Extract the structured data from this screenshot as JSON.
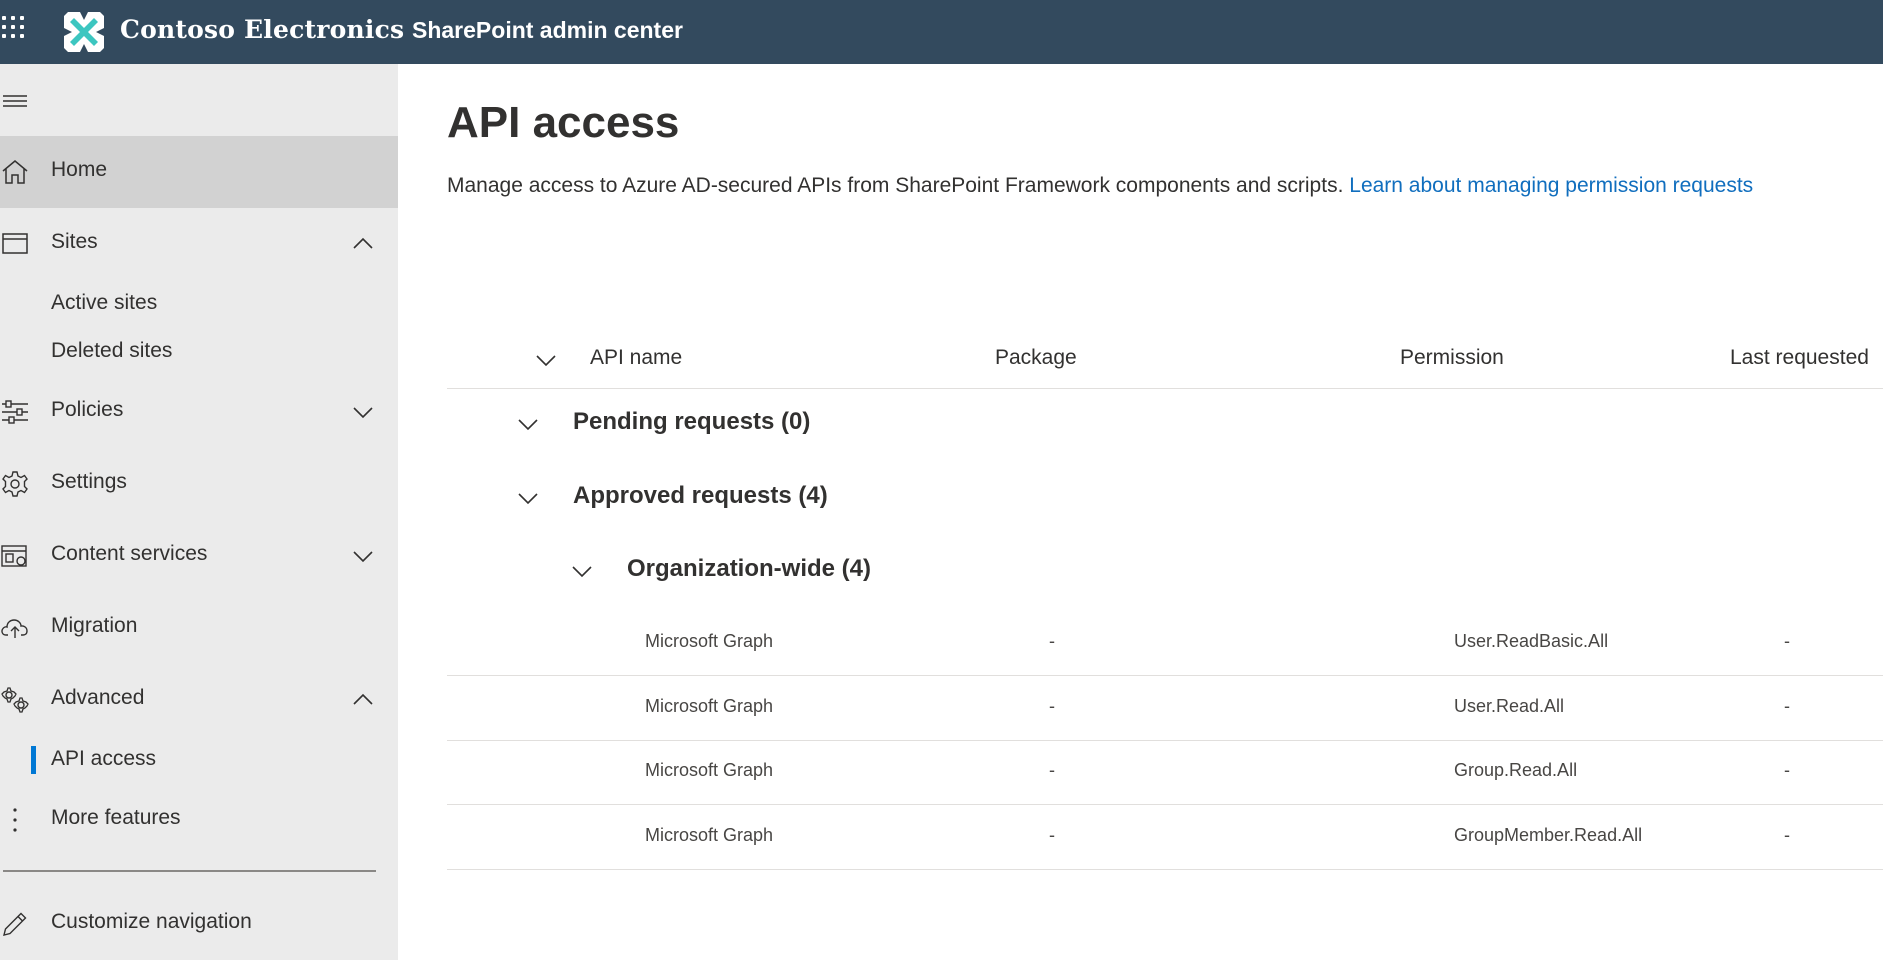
{
  "header": {
    "brand": "Contoso Electronics",
    "app_name": "SharePoint admin center",
    "bar_color": "#334a5e"
  },
  "sidebar": {
    "items": [
      {
        "label": "Home",
        "icon": "home-icon",
        "selected": true
      },
      {
        "label": "Sites",
        "icon": "sites-icon",
        "expanded": true,
        "children": [
          {
            "label": "Active sites"
          },
          {
            "label": "Deleted sites"
          }
        ]
      },
      {
        "label": "Policies",
        "icon": "policies-icon",
        "expanded": false
      },
      {
        "label": "Settings",
        "icon": "gear-icon"
      },
      {
        "label": "Content services",
        "icon": "content-services-icon",
        "expanded": false
      },
      {
        "label": "Migration",
        "icon": "cloud-upload-icon"
      },
      {
        "label": "Advanced",
        "icon": "advanced-icon",
        "expanded": true,
        "children": [
          {
            "label": "API access",
            "active": true
          }
        ]
      },
      {
        "label": "More features",
        "icon": "more-icon"
      }
    ],
    "customize": {
      "label": "Customize navigation",
      "icon": "edit-icon"
    },
    "accent_color": "#0078d4"
  },
  "page": {
    "title": "API access",
    "description": "Manage access to Azure AD-secured APIs from SharePoint Framework components and scripts.",
    "link_text": "Learn about managing permission requests"
  },
  "table": {
    "columns": [
      "API name",
      "Package",
      "Permission",
      "Last requested"
    ],
    "groups": {
      "pending": "Pending requests (0)",
      "approved": "Approved requests (4)",
      "org_wide": "Organization-wide (4)"
    },
    "rows": [
      {
        "api": "Microsoft Graph",
        "package": "-",
        "permission": "User.ReadBasic.All",
        "last_requested": "-"
      },
      {
        "api": "Microsoft Graph",
        "package": "-",
        "permission": "User.Read.All",
        "last_requested": "-"
      },
      {
        "api": "Microsoft Graph",
        "package": "-",
        "permission": "Group.Read.All",
        "last_requested": "-"
      },
      {
        "api": "Microsoft Graph",
        "package": "-",
        "permission": "GroupMember.Read.All",
        "last_requested": "-"
      }
    ]
  }
}
